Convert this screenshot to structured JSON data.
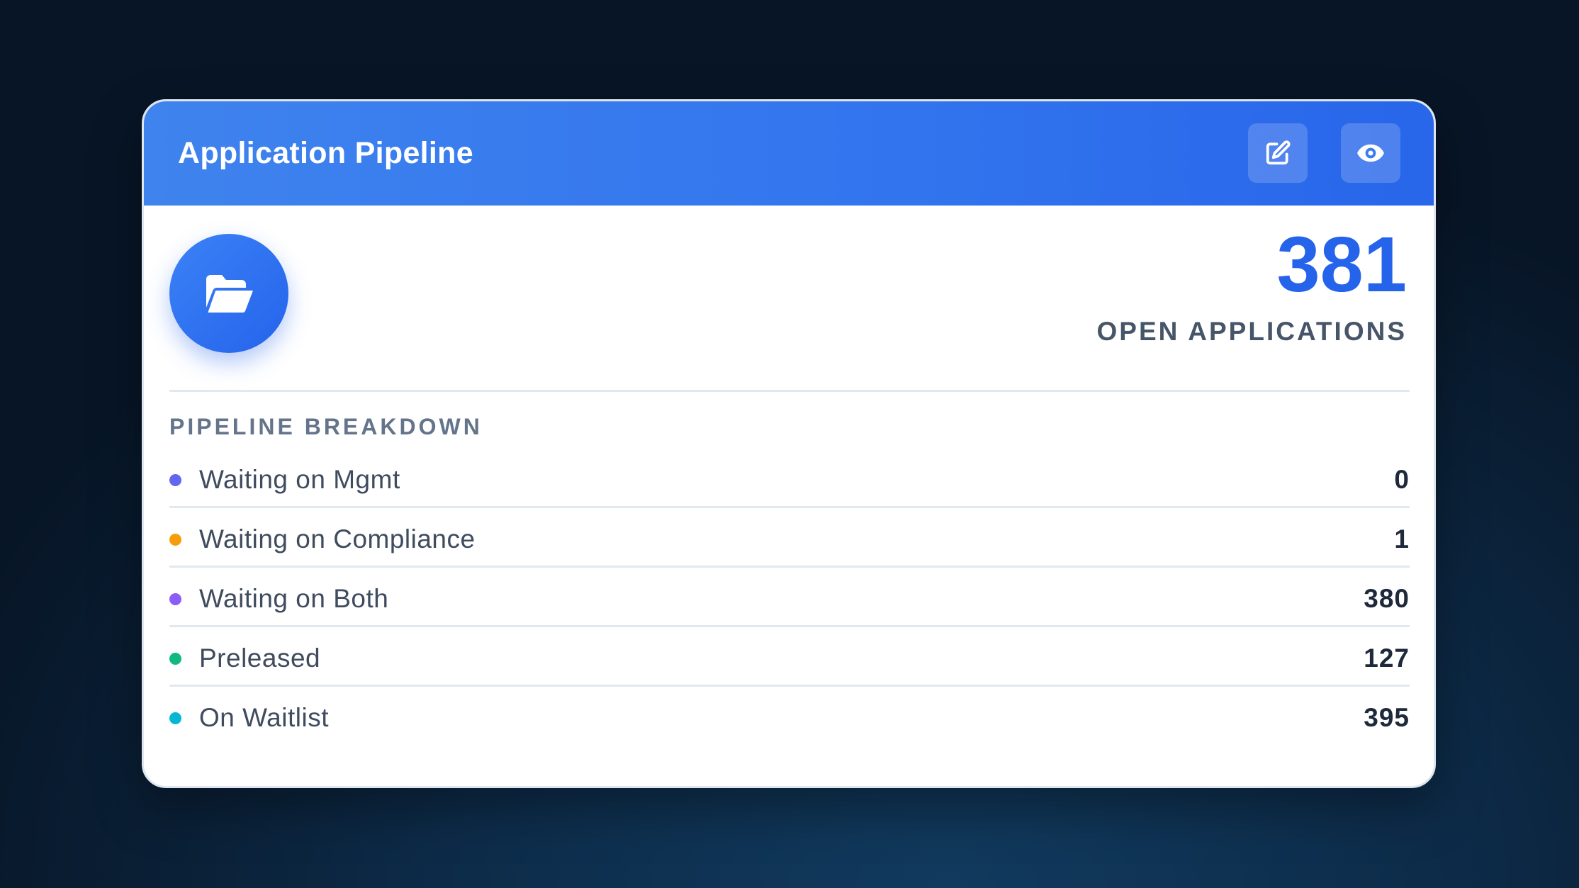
{
  "card": {
    "title": "Application Pipeline",
    "header_buttons": [
      {
        "name": "edit",
        "icon": "edit-icon"
      },
      {
        "name": "view",
        "icon": "eye-icon"
      }
    ],
    "hero_icon": "folder-open-icon",
    "total": "381",
    "total_label": "OPEN APPLICATIONS",
    "breakdown_title": "PIPELINE BREAKDOWN",
    "breakdown": [
      {
        "label": "Waiting on Mgmt",
        "value": "0",
        "color": "#6366f1"
      },
      {
        "label": "Waiting on Compliance",
        "value": "1",
        "color": "#f59e0b"
      },
      {
        "label": "Waiting on Both",
        "value": "380",
        "color": "#8b5cf6"
      },
      {
        "label": "Preleased",
        "value": "127",
        "color": "#10b981"
      },
      {
        "label": "On Waitlist",
        "value": "395",
        "color": "#06b6d4"
      }
    ]
  },
  "colors": {
    "accent": "#2563eb",
    "header_gradient_start": "#3f83ee",
    "header_gradient_end": "#2866ea"
  }
}
